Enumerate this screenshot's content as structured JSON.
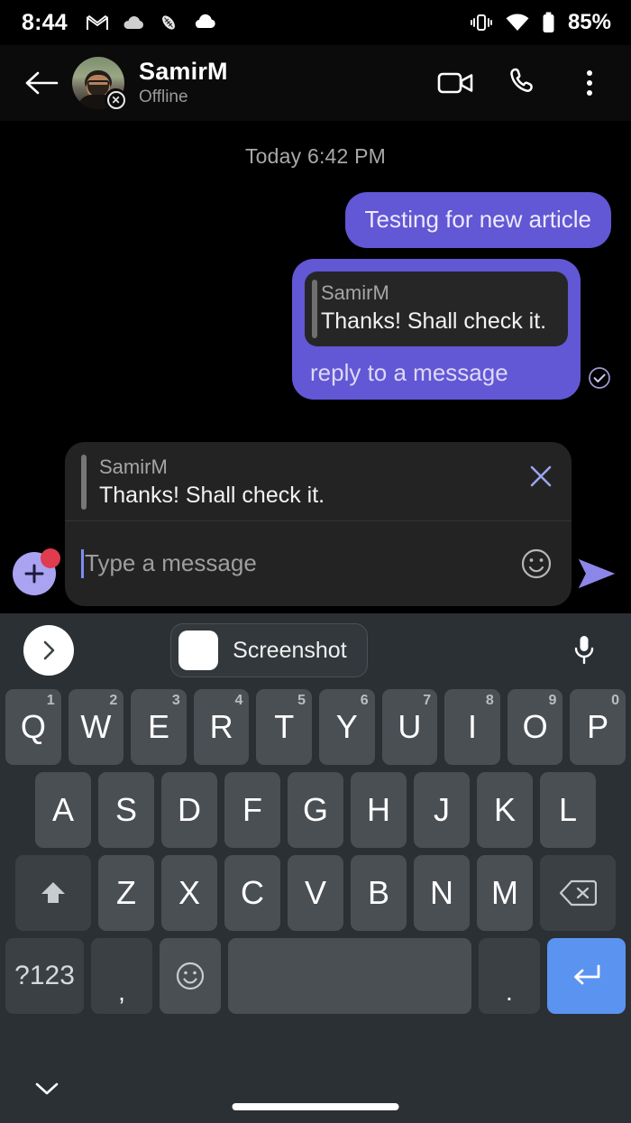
{
  "status_bar": {
    "time": "8:44",
    "battery_text": "85%",
    "left_icons": [
      "gmail-icon",
      "cloud-icon",
      "football-icon",
      "cloud-icon"
    ],
    "right_icons": [
      "vibrate-icon",
      "wifi-icon",
      "battery-icon"
    ]
  },
  "chat_header": {
    "back_label": "back-arrow",
    "peer_name": "SamirM",
    "peer_status": "Offline",
    "presence_badge": "offline-badge",
    "actions": [
      {
        "name": "video-call-button",
        "icon": "video-camera-icon"
      },
      {
        "name": "voice-call-button",
        "icon": "phone-icon"
      },
      {
        "name": "overflow-menu-button",
        "icon": "three-dots-icon"
      }
    ]
  },
  "conversation": {
    "day_separator": "Today 6:42 PM",
    "messages": [
      {
        "id": "msg-1",
        "direction": "outgoing",
        "text": "Testing for new article"
      },
      {
        "id": "msg-2",
        "direction": "outgoing",
        "quote_author": "SamirM",
        "quote_text": "Thanks! Shall check it.",
        "text": "reply to a message",
        "delivery_status": "delivered"
      }
    ]
  },
  "composer": {
    "attach_button": "plus-button",
    "attach_badge": "new-indicator-dot",
    "reply_preview": {
      "author": "SamirM",
      "text": "Thanks! Shall check it.",
      "close_label": "close-reply"
    },
    "input_value": "",
    "input_placeholder": "Type a message",
    "emoji_button": "emoji-icon",
    "send_button": "send-icon"
  },
  "keyboard": {
    "suggestion_bar": {
      "expand_label": "expand-toolbar",
      "chip_label": "Screenshot",
      "chip_thumb": "screenshot-thumbnail",
      "mic_label": "voice-input"
    },
    "row1": [
      {
        "key": "Q",
        "sup": "1"
      },
      {
        "key": "W",
        "sup": "2"
      },
      {
        "key": "E",
        "sup": "3"
      },
      {
        "key": "R",
        "sup": "4"
      },
      {
        "key": "T",
        "sup": "5"
      },
      {
        "key": "Y",
        "sup": "6"
      },
      {
        "key": "U",
        "sup": "7"
      },
      {
        "key": "I",
        "sup": "8"
      },
      {
        "key": "O",
        "sup": "9"
      },
      {
        "key": "P",
        "sup": "0"
      }
    ],
    "row2": [
      {
        "key": "A"
      },
      {
        "key": "S"
      },
      {
        "key": "D"
      },
      {
        "key": "F"
      },
      {
        "key": "G"
      },
      {
        "key": "H"
      },
      {
        "key": "J"
      },
      {
        "key": "K"
      },
      {
        "key": "L"
      }
    ],
    "row3": [
      {
        "key": "Z"
      },
      {
        "key": "X"
      },
      {
        "key": "C"
      },
      {
        "key": "V"
      },
      {
        "key": "B"
      },
      {
        "key": "N"
      },
      {
        "key": "M"
      }
    ],
    "shift_label": "shift-key",
    "backspace_label": "backspace-key",
    "symbols_label": "?123",
    "comma_label": ",",
    "emoji_key_label": "emoji-key",
    "space_label": "space-key",
    "period_label": ".",
    "enter_label": "enter-key"
  },
  "nav_bar": {
    "hide_keyboard_label": "hide-keyboard",
    "home_indicator_label": "home-indicator"
  },
  "colors": {
    "bubble_purple": "#6257d4",
    "accent_send": "#a9a3f2",
    "enter_blue": "#5b93f0",
    "badge_red": "#e03b4e",
    "keyboard_bg": "#2b3034"
  }
}
